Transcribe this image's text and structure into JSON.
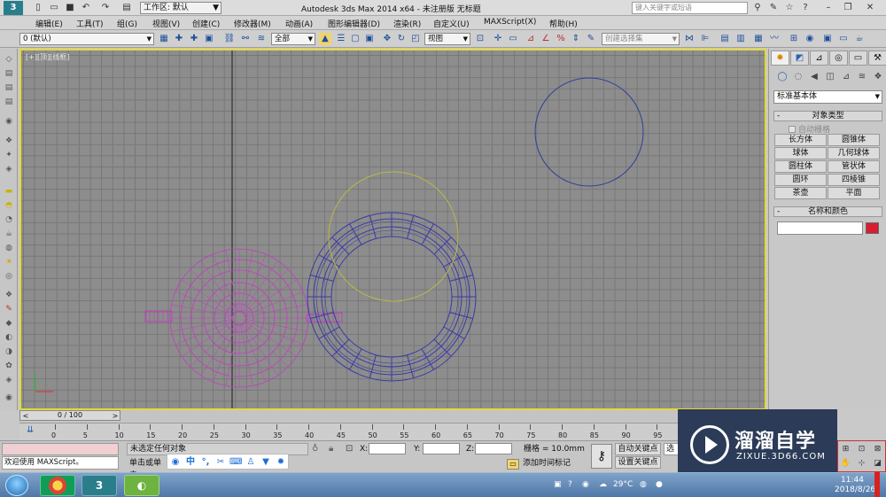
{
  "titlebar": {
    "logo": "3",
    "workspace_label": "工作区: 默认",
    "app_title": "Autodesk 3ds Max  2014 x64  - 未注册版   无标题",
    "search_placeholder": "键入关键字或短语"
  },
  "menu": [
    "编辑(E)",
    "工具(T)",
    "组(G)",
    "视图(V)",
    "创建(C)",
    "修改器(M)",
    "动画(A)",
    "图形编辑器(D)",
    "渲染(R)",
    "自定义(U)",
    "MAXScript(X)",
    "帮助(H)"
  ],
  "toolbar": {
    "layer": "0 (默认)",
    "filter": "全部",
    "refcoord": "视图",
    "selset_placeholder": "创建选择集"
  },
  "viewport": {
    "label": "[+][顶][线框]"
  },
  "command_panel": {
    "category": "标准基本体",
    "object_type_header": "对象类型",
    "autogrid": "自动栅格",
    "buttons": [
      "长方体",
      "圆锥体",
      "球体",
      "几何球体",
      "圆柱体",
      "管状体",
      "圆环",
      "四棱锥",
      "茶壶",
      "平面"
    ],
    "name_color_header": "名称和颜色",
    "swatch_color": "#d71f2f"
  },
  "timeline": {
    "slider_label": "0 / 100",
    "ticks": [
      "0",
      "5",
      "10",
      "15",
      "20",
      "25",
      "30",
      "35",
      "40",
      "45",
      "50",
      "55",
      "60",
      "65",
      "70",
      "75",
      "80",
      "85",
      "90",
      "95",
      "100"
    ]
  },
  "status": {
    "maxscript_welcome": "欢迎使用 MAXScript。",
    "selection": "未选定任何对象",
    "prompt": "单击或单击",
    "x_label": "X:",
    "y_label": "Y:",
    "z_label": "Z:",
    "grid": "栅格 = 10.0mm",
    "add_time_tag": "添加时间标记",
    "auto_key": "自动关键点",
    "set_key": "设置关键点",
    "selected": "选定"
  },
  "watermark": {
    "title": "溜溜自学",
    "url": "ZIXUE.3D66.COM"
  },
  "taskbar": {
    "temperature": "29°C",
    "time": "11:44",
    "date": "2018/8/26"
  },
  "colors": {
    "viewport_border": "#e2d93a",
    "teapot_wire": "#c13ec1",
    "torus_wire": "#3a3aa8",
    "circle_yellow": "#b8b84a",
    "circle_blue": "#2d3f9a"
  }
}
